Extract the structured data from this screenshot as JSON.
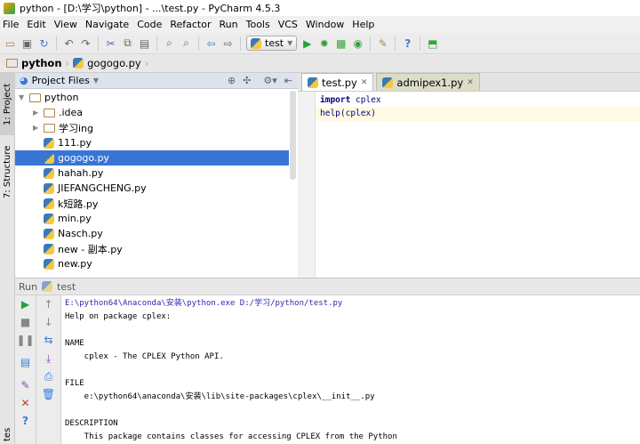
{
  "window": {
    "title": "python - [D:\\学习\\python] - ...\\test.py - PyCharm 4.5.3"
  },
  "menu": [
    "File",
    "Edit",
    "View",
    "Navigate",
    "Code",
    "Refactor",
    "Run",
    "Tools",
    "VCS",
    "Window",
    "Help"
  ],
  "toolbar": {
    "run_config": "test"
  },
  "breadcrumb": [
    "python",
    "gogogo.py"
  ],
  "side_tabs": {
    "project": "1: Project",
    "structure": "7: Structure",
    "favorites": "tes"
  },
  "project_panel": {
    "view": "Project Files",
    "tree": [
      {
        "label": "python",
        "type": "folder",
        "level": 0,
        "expanded": true
      },
      {
        "label": ".idea",
        "type": "folder",
        "level": 1
      },
      {
        "label": "学习ing",
        "type": "folder",
        "level": 1
      },
      {
        "label": "111.py",
        "type": "file",
        "level": 1
      },
      {
        "label": "gogogo.py",
        "type": "file",
        "level": 1,
        "selected": true
      },
      {
        "label": "hahah.py",
        "type": "file",
        "level": 1
      },
      {
        "label": "JIEFANGCHENG.py",
        "type": "file",
        "level": 1
      },
      {
        "label": "k短路.py",
        "type": "file",
        "level": 1
      },
      {
        "label": "min.py",
        "type": "file",
        "level": 1
      },
      {
        "label": "Nasch.py",
        "type": "file",
        "level": 1
      },
      {
        "label": "new - 副本.py",
        "type": "file",
        "level": 1
      },
      {
        "label": "new.py",
        "type": "file",
        "level": 1
      }
    ]
  },
  "editor": {
    "tabs": [
      {
        "label": "test.py",
        "active": true
      },
      {
        "label": "admipex1.py",
        "active": false
      }
    ],
    "lines": [
      {
        "kw": "import",
        "rest": " cplex"
      },
      {
        "kw": "",
        "rest": "help(cplex)"
      }
    ]
  },
  "run": {
    "label": "Run",
    "config": "test",
    "output": [
      {
        "text": "E:\\python64\\Anaconda\\安装\\python.exe D:/学习/python/test.py",
        "color": "#2b2bb0"
      },
      {
        "text": "Help on package cplex:",
        "color": "#000"
      },
      {
        "text": "",
        "color": "#000"
      },
      {
        "text": "NAME",
        "color": "#000"
      },
      {
        "text": "    cplex - The CPLEX Python API.",
        "color": "#000"
      },
      {
        "text": "",
        "color": "#000"
      },
      {
        "text": "FILE",
        "color": "#000"
      },
      {
        "text": "    e:\\python64\\anaconda\\安装\\lib\\site-packages\\cplex\\__init__.py",
        "color": "#000"
      },
      {
        "text": "",
        "color": "#000"
      },
      {
        "text": "DESCRIPTION",
        "color": "#000"
      },
      {
        "text": "    This package contains classes for accessing CPLEX from the Python",
        "color": "#000"
      }
    ]
  }
}
